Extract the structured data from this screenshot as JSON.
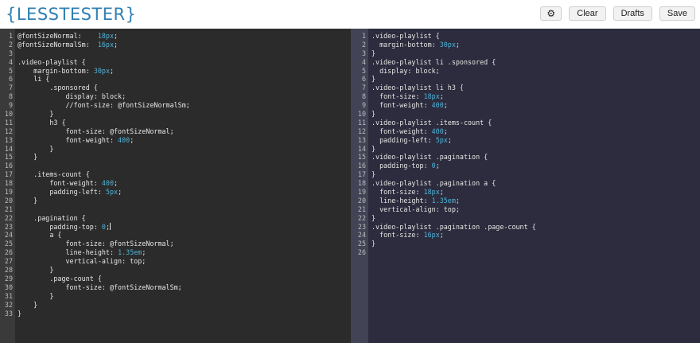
{
  "app": {
    "logo": "{LESSTESTER}",
    "buttons": {
      "settings_icon": "⚙",
      "clear": "Clear",
      "drafts": "Drafts",
      "save": "Save"
    }
  },
  "colors": {
    "accent": "#2f7fb3",
    "editor_bg": "#2b2b2b",
    "output_bg": "#2c2c3e",
    "number": "#4fb3d9"
  },
  "editor": {
    "lines": [
      "@fontSizeNormal:    18px;",
      "@fontSizeNormalSm:  16px;",
      "",
      ".video-playlist {",
      "    margin-bottom: 30px;",
      "    li {",
      "        .sponsored {",
      "            display: block;",
      "            //font-size: @fontSizeNormalSm;",
      "        }",
      "        h3 {",
      "            font-size: @fontSizeNormal;",
      "            font-weight: 400;",
      "        }",
      "    }",
      "",
      "    .items-count {",
      "        font-weight: 400;",
      "        padding-left: 5px;",
      "    }",
      "",
      "    .pagination {",
      "        padding-top: 0;",
      "        a {",
      "            font-size: @fontSizeNormal;",
      "            line-height: 1.35em;",
      "            vertical-align: top;",
      "        }",
      "        .page-count {",
      "            font-size: @fontSizeNormalSm;",
      "        }",
      "    }",
      "}"
    ],
    "cursor_line": 23
  },
  "output": {
    "lines": [
      ".video-playlist {",
      "  margin-bottom: 30px;",
      "}",
      ".video-playlist li .sponsored {",
      "  display: block;",
      "}",
      ".video-playlist li h3 {",
      "  font-size: 18px;",
      "  font-weight: 400;",
      "}",
      ".video-playlist .items-count {",
      "  font-weight: 400;",
      "  padding-left: 5px;",
      "}",
      ".video-playlist .pagination {",
      "  padding-top: 0;",
      "}",
      ".video-playlist .pagination a {",
      "  font-size: 18px;",
      "  line-height: 1.35em;",
      "  vertical-align: top;",
      "}",
      ".video-playlist .pagination .page-count {",
      "  font-size: 16px;",
      "}",
      ""
    ]
  }
}
